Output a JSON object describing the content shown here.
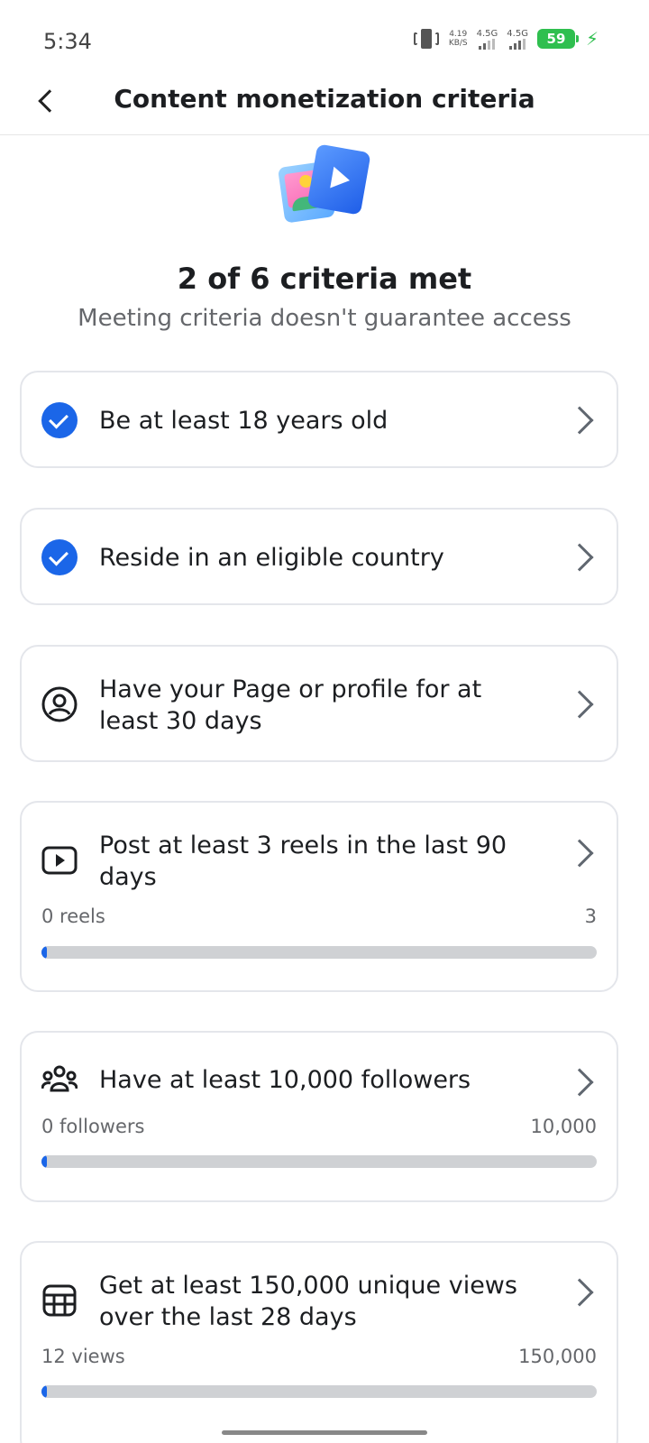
{
  "status_bar": {
    "time": "5:34",
    "net_speed_value": "4.19",
    "net_speed_unit": "KB/S",
    "sim1_label": "4.5G",
    "sim2_label": "4.5G",
    "battery_level": "59"
  },
  "header": {
    "title": "Content monetization criteria"
  },
  "summary": {
    "title": "2 of 6 criteria met",
    "subtitle": "Meeting criteria doesn't guarantee access"
  },
  "criteria": [
    {
      "label": "Be at least 18 years old",
      "met": true,
      "icon": "check-circle-icon"
    },
    {
      "label": "Reside in an eligible country",
      "met": true,
      "icon": "check-circle-icon"
    },
    {
      "label": "Have your Page or profile for at least 30 days",
      "met": false,
      "icon": "profile-icon"
    },
    {
      "label": "Post at least 3 reels in the last 90 days",
      "met": false,
      "icon": "play-icon",
      "progress": {
        "current_label": "0 reels",
        "target_label": "3",
        "fraction": 0.0
      }
    },
    {
      "label": "Have at least 10,000 followers",
      "met": false,
      "icon": "people-icon",
      "progress": {
        "current_label": "0 followers",
        "target_label": "10,000",
        "fraction": 0.0
      }
    },
    {
      "label": "Get at least 150,000 unique views over the last 28 days",
      "met": false,
      "icon": "calendar-grid-icon",
      "progress": {
        "current_label": "12 views",
        "target_label": "150,000",
        "fraction": 8e-05
      }
    }
  ],
  "colors": {
    "accent": "#1b66e8",
    "track": "#cfd1d4",
    "battery": "#2fbf4f"
  }
}
